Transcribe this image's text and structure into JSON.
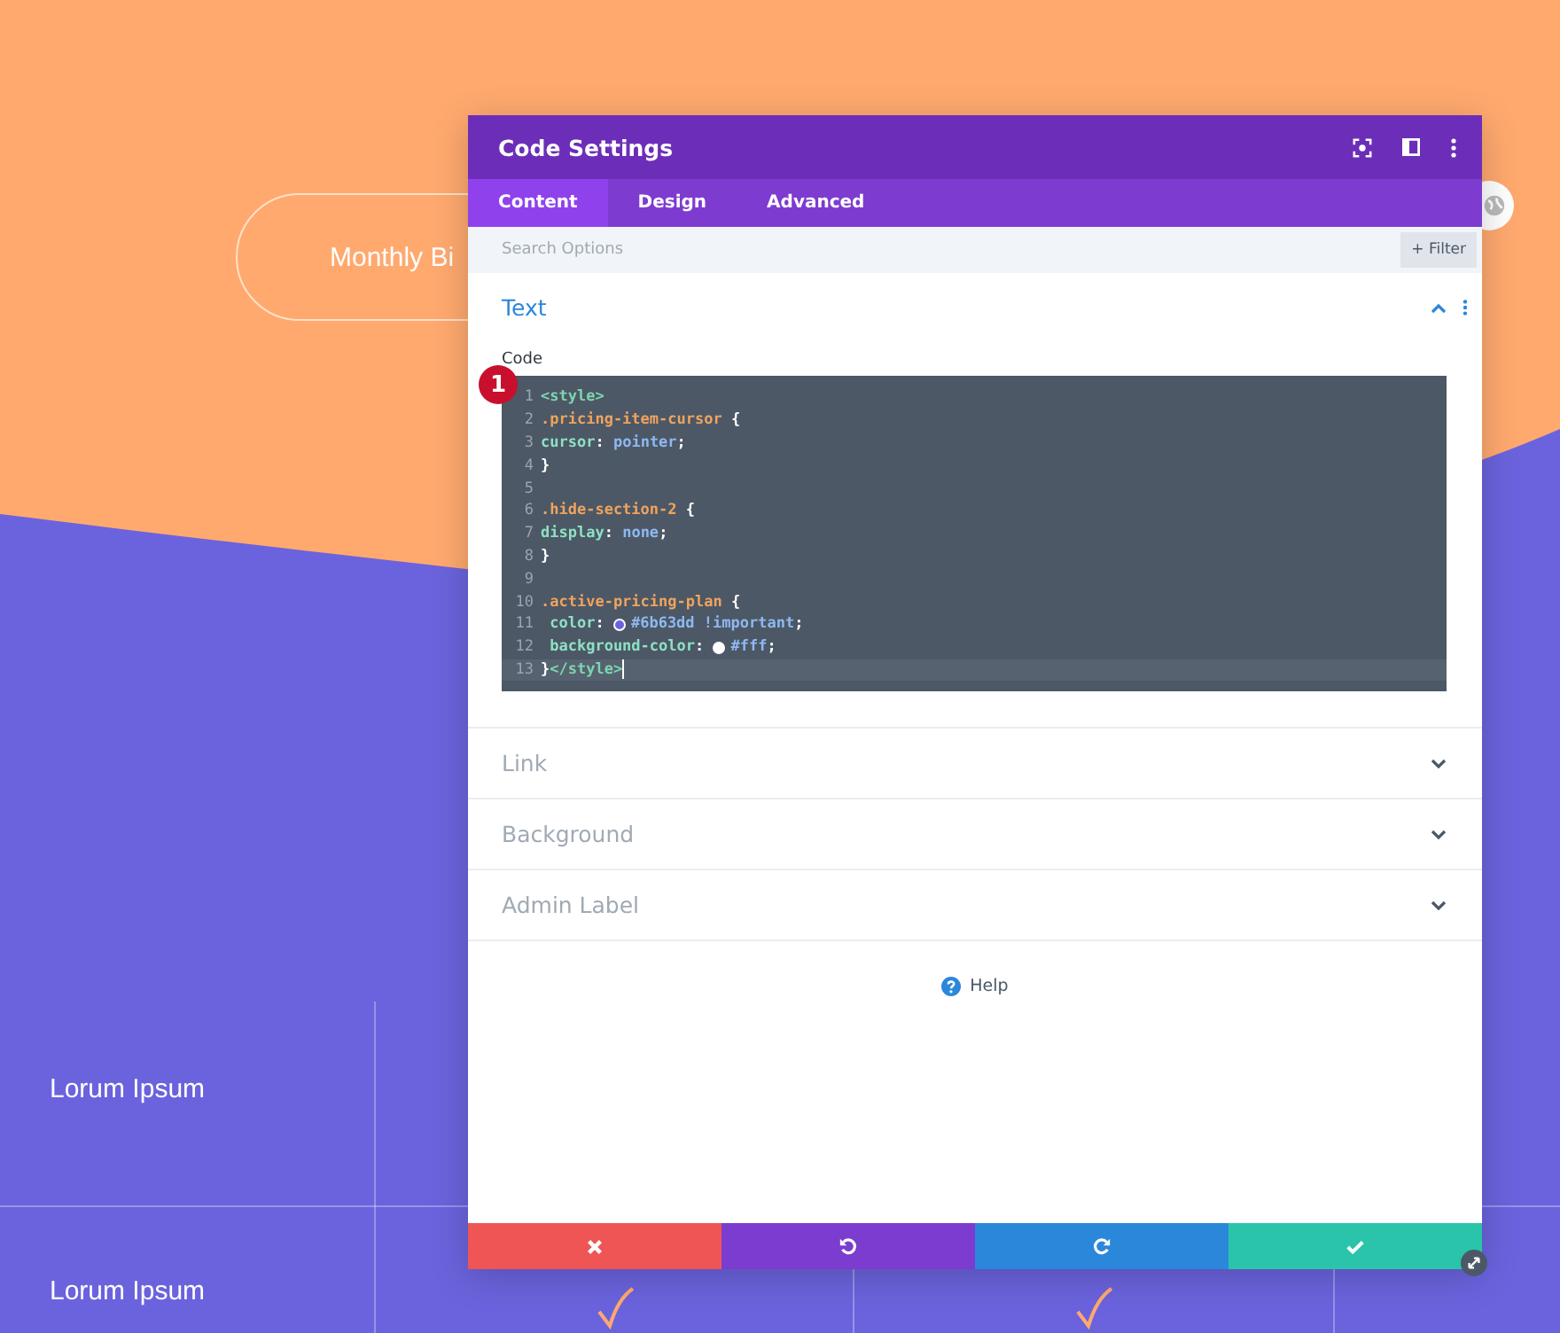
{
  "page": {
    "toggle_label": "Monthly Bi",
    "rows": [
      {
        "label": "Lorum Ipsum"
      },
      {
        "label": "Lorum Ipsum"
      }
    ]
  },
  "modal": {
    "title": "Code Settings",
    "tabs": [
      {
        "label": "Content",
        "selected": true
      },
      {
        "label": "Design",
        "selected": false
      },
      {
        "label": "Advanced",
        "selected": false
      }
    ],
    "search": {
      "placeholder": "Search Options"
    },
    "filter_button": "+ Filter",
    "sections": [
      {
        "title": "Text",
        "expanded": true,
        "field_label": "Code",
        "step_badge": "1",
        "lines": [
          {
            "number": "1",
            "selected": false,
            "tokens": [
              {
                "kind": "tag",
                "text": "<style>"
              }
            ]
          },
          {
            "number": "2",
            "selected": false,
            "tokens": [
              {
                "kind": "selector",
                "text": ".pricing-item-cursor"
              },
              {
                "kind": "punct",
                "text": " {"
              }
            ]
          },
          {
            "number": "3",
            "selected": false,
            "tokens": [
              {
                "kind": "property",
                "text": "cursor"
              },
              {
                "kind": "punct",
                "text": ": "
              },
              {
                "kind": "value",
                "text": "pointer"
              },
              {
                "kind": "punct",
                "text": ";"
              }
            ]
          },
          {
            "number": "4",
            "selected": false,
            "tokens": [
              {
                "kind": "punct",
                "text": "}"
              }
            ]
          },
          {
            "number": "5",
            "selected": false
          },
          {
            "number": "6",
            "selected": false,
            "tokens": [
              {
                "kind": "selector",
                "text": ".hide-section-2"
              },
              {
                "kind": "punct",
                "text": " {"
              }
            ]
          },
          {
            "number": "7",
            "selected": false,
            "tokens": [
              {
                "kind": "property",
                "text": "display"
              },
              {
                "kind": "punct",
                "text": ": "
              },
              {
                "kind": "value",
                "text": "none"
              },
              {
                "kind": "punct",
                "text": ";"
              }
            ]
          },
          {
            "number": "8",
            "selected": false,
            "tokens": [
              {
                "kind": "punct",
                "text": "}"
              }
            ]
          },
          {
            "number": "9",
            "selected": false
          },
          {
            "number": "10",
            "selected": false,
            "tokens": [
              {
                "kind": "selector",
                "text": ".active-pricing-plan"
              },
              {
                "kind": "punct",
                "text": " {"
              }
            ]
          },
          {
            "number": "11",
            "selected": false,
            "tokens": [
              {
                "kind": "property",
                "text": " color"
              },
              {
                "kind": "punct",
                "text": ": "
              },
              {
                "kind": "swatch",
                "color": "#6b63dd"
              },
              {
                "kind": "value",
                "text": "#6b63dd !important"
              },
              {
                "kind": "punct",
                "text": ";"
              }
            ]
          },
          {
            "number": "12",
            "selected": false,
            "tokens": [
              {
                "kind": "property",
                "text": " background-color"
              },
              {
                "kind": "punct",
                "text": ": "
              },
              {
                "kind": "swatch",
                "color": "#ffffff"
              },
              {
                "kind": "value",
                "text": "#fff"
              },
              {
                "kind": "punct",
                "text": ";"
              }
            ]
          },
          {
            "number": "13",
            "selected": true,
            "tokens": [
              {
                "kind": "punct",
                "text": "}"
              },
              {
                "kind": "tag",
                "text": "</style>"
              }
            ]
          }
        ]
      },
      {
        "title": "Link",
        "expanded": false
      },
      {
        "title": "Background",
        "expanded": false
      },
      {
        "title": "Admin Label",
        "expanded": false
      }
    ],
    "help": "Help",
    "footer_buttons": [
      {
        "kind": "cancel"
      },
      {
        "kind": "undo"
      },
      {
        "kind": "redo"
      },
      {
        "kind": "save"
      }
    ]
  }
}
